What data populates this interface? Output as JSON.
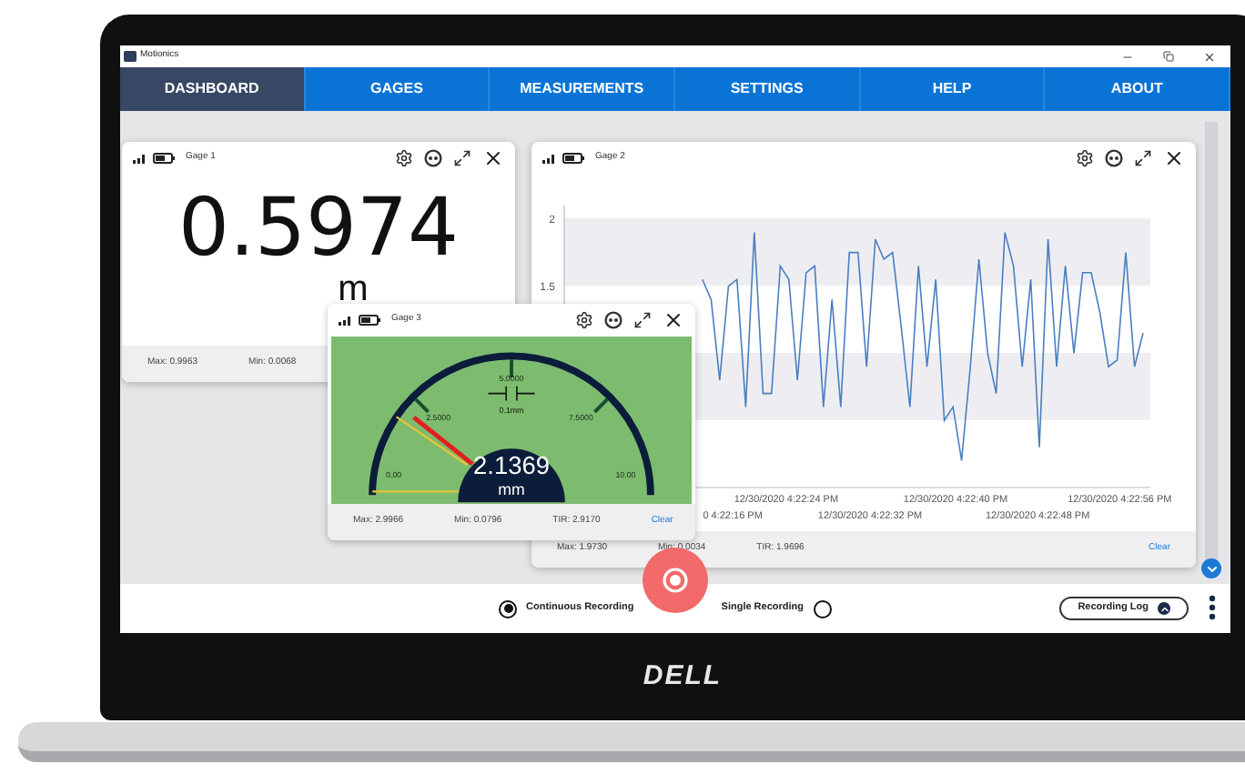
{
  "window": {
    "title": "Motionics"
  },
  "tabs": [
    {
      "label": "DASHBOARD",
      "selected": true
    },
    {
      "label": "GAGES",
      "selected": false
    },
    {
      "label": "MEASUREMENTS",
      "selected": false
    },
    {
      "label": "SETTINGS",
      "selected": false
    },
    {
      "label": "HELP",
      "selected": false
    },
    {
      "label": "ABOUT",
      "selected": false
    }
  ],
  "gages": [
    {
      "kind": "digital",
      "name": "Gage 1",
      "reading": "0.5974",
      "unit": "m",
      "stats": [
        "Max: 0.9963",
        "Min: 0.0068"
      ]
    },
    {
      "kind": "chart",
      "name": "Gage 2",
      "stats": [
        "Max: 1.9730",
        "Min: 0.0034",
        "TIR: 1.9696"
      ],
      "clear": "Clear",
      "time_labels": [
        "0 4:22:16 PM",
        "12/30/2020 4:22:24 PM",
        "12/30/2020 4:22:32 PM",
        "12/30/2020 4:22:40 PM",
        "12/30/2020 4:22:48 PM",
        "12/30/2020 4:22:56 PM"
      ],
      "chart_data": {
        "type": "line",
        "ylim": [
          0,
          2.1
        ],
        "yticks": [
          1.5,
          2
        ],
        "series": [
          {
            "color": "#4a7fc1",
            "values": [
              null,
              null,
              null,
              null,
              null,
              null,
              null,
              null,
              null,
              null,
              null,
              null,
              null,
              null,
              null,
              null,
              1.55,
              1.4,
              0.8,
              1.5,
              1.55,
              0.6,
              1.9,
              0.7,
              0.7,
              1.65,
              1.55,
              0.8,
              1.6,
              1.65,
              0.6,
              1.4,
              0.6,
              1.75,
              1.75,
              0.9,
              1.85,
              1.7,
              1.75,
              1.2,
              0.6,
              1.65,
              0.9,
              1.55,
              0.5,
              0.6,
              0.2,
              0.9,
              1.7,
              1.0,
              0.7,
              1.9,
              1.65,
              0.9,
              1.55,
              0.3,
              1.85,
              0.9,
              1.65,
              1.0,
              1.6,
              1.6,
              1.3,
              0.9,
              0.95,
              1.75,
              0.9,
              1.15
            ]
          }
        ]
      }
    },
    {
      "kind": "dial",
      "name": "Gage 3",
      "reading": "2.1369",
      "unit": "mm",
      "level": 0.214,
      "scale": [
        "0.00",
        "2.5000",
        "5.0000",
        "7.5000",
        "10.00"
      ],
      "tolerance": "0.1mm",
      "stats": [
        "Max: 2.9966",
        "Min: 0.0796",
        "TIR: 2.9170"
      ],
      "clear": "Clear"
    }
  ],
  "recording": [
    {
      "label": "Continuous Recording",
      "selected": true
    },
    {
      "label": "Single Recording",
      "selected": false
    }
  ],
  "log_button": "Recording Log",
  "brand": "DELL"
}
